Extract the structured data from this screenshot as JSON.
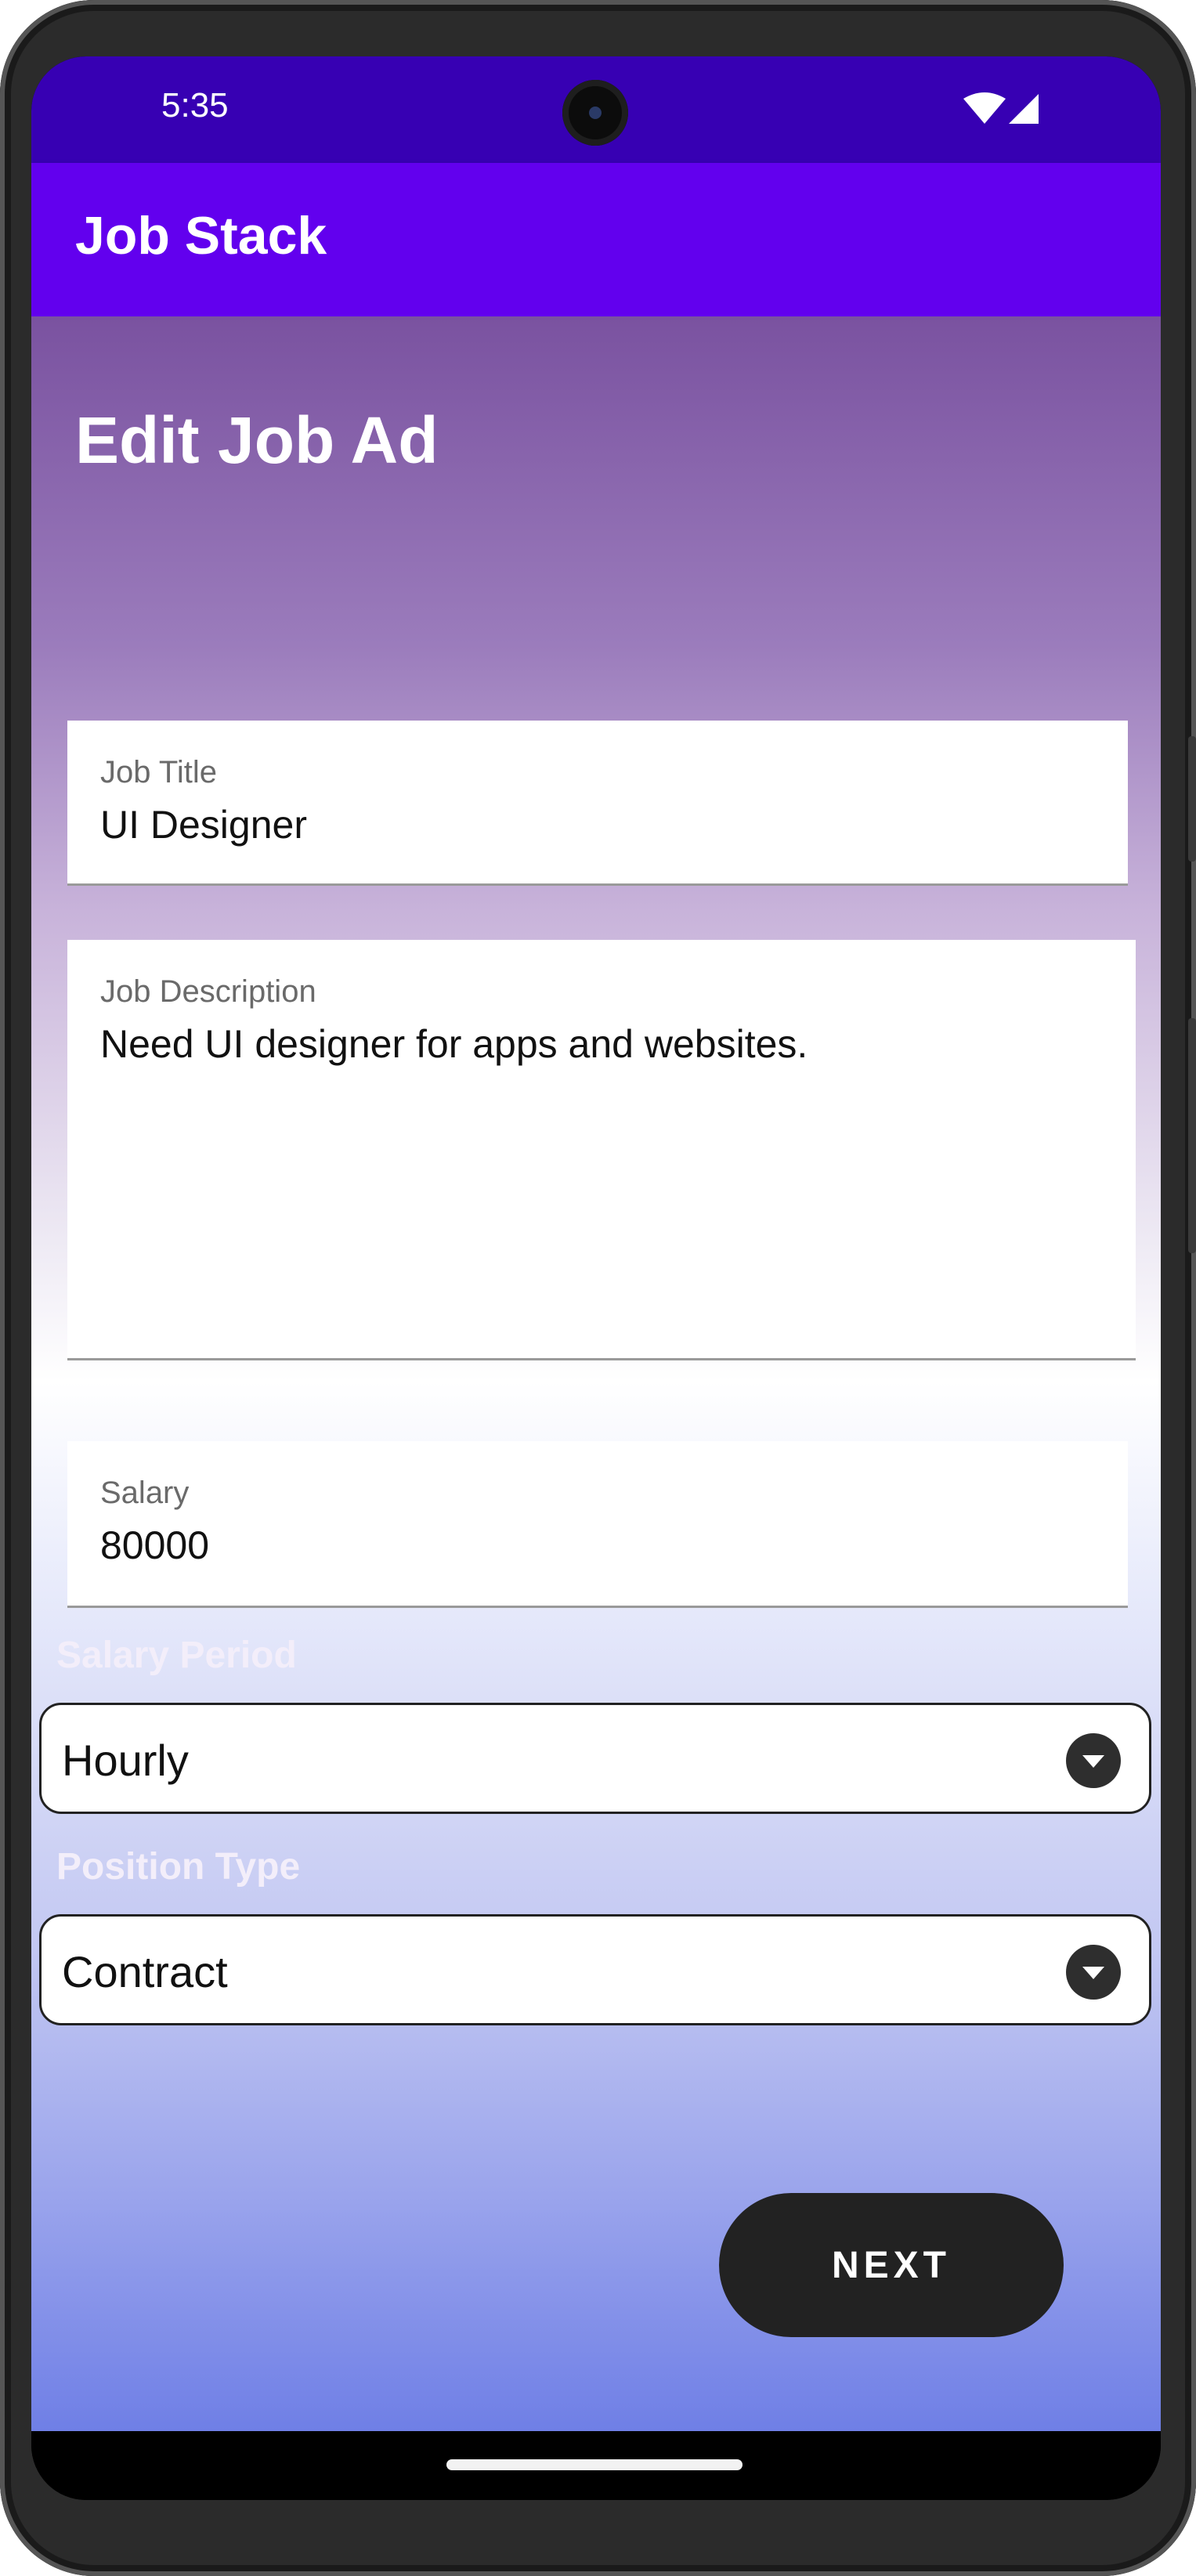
{
  "status_bar": {
    "time": "5:35",
    "icons": [
      "wifi-icon",
      "signal-icon"
    ]
  },
  "app_bar": {
    "title": "Job Stack",
    "color": "#6200ee"
  },
  "page": {
    "title": "Edit Job Ad"
  },
  "form": {
    "job_title": {
      "label": "Job Title",
      "value": "UI Designer"
    },
    "job_description": {
      "label": "Job Description",
      "value": "Need UI designer for apps and websites."
    },
    "salary": {
      "label": "Salary",
      "value": "80000"
    },
    "salary_period": {
      "label": "Salary Period",
      "selected": "Hourly"
    },
    "position_type": {
      "label": "Position Type",
      "selected": "Contract"
    }
  },
  "actions": {
    "next_label": "NEXT"
  }
}
